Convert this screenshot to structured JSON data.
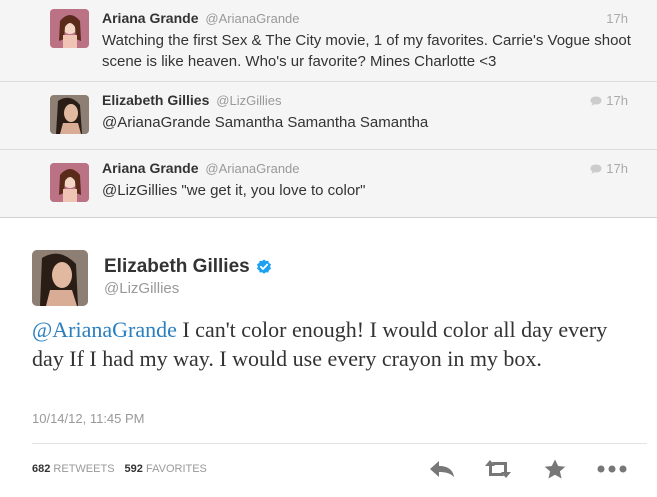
{
  "replies": [
    {
      "name": "Ariana Grande",
      "handle": "@ArianaGrande",
      "time": "17h",
      "text": "Watching the first Sex & The City movie, 1 of my favorites. Carrie's Vogue shoot scene is like heaven. Who's ur favorite? Mines Charlotte <3"
    },
    {
      "name": "Elizabeth Gillies",
      "handle": "@LizGillies",
      "time": "17h",
      "text": "@ArianaGrande Samantha Samantha Samantha"
    },
    {
      "name": "Ariana Grande",
      "handle": "@ArianaGrande",
      "time": "17h",
      "text": "@LizGillies \"we get it, you love to color\""
    }
  ],
  "main_tweet": {
    "name": "Elizabeth Gillies",
    "handle": "@LizGillies",
    "mention": "@ArianaGrande",
    "text": " I can't color enough! I would color all day every day If I had my way. I would use every crayon in my box.",
    "date": "10/14/12, 11:45 PM",
    "retweets_count": "682",
    "retweets_label": "RETWEETS",
    "favorites_count": "592",
    "favorites_label": "FAVORITES"
  },
  "icons": {
    "reply": "reply-icon",
    "retweet": "retweet-icon",
    "favorite": "star-icon",
    "more": "more-icon",
    "verified": "verified-badge-icon",
    "conversation": "speech-bubble-icon"
  },
  "colors": {
    "link": "#2a7fbf",
    "verified": "#1da1f2",
    "muted": "#999999",
    "reply_background": "#f5f5f5"
  }
}
